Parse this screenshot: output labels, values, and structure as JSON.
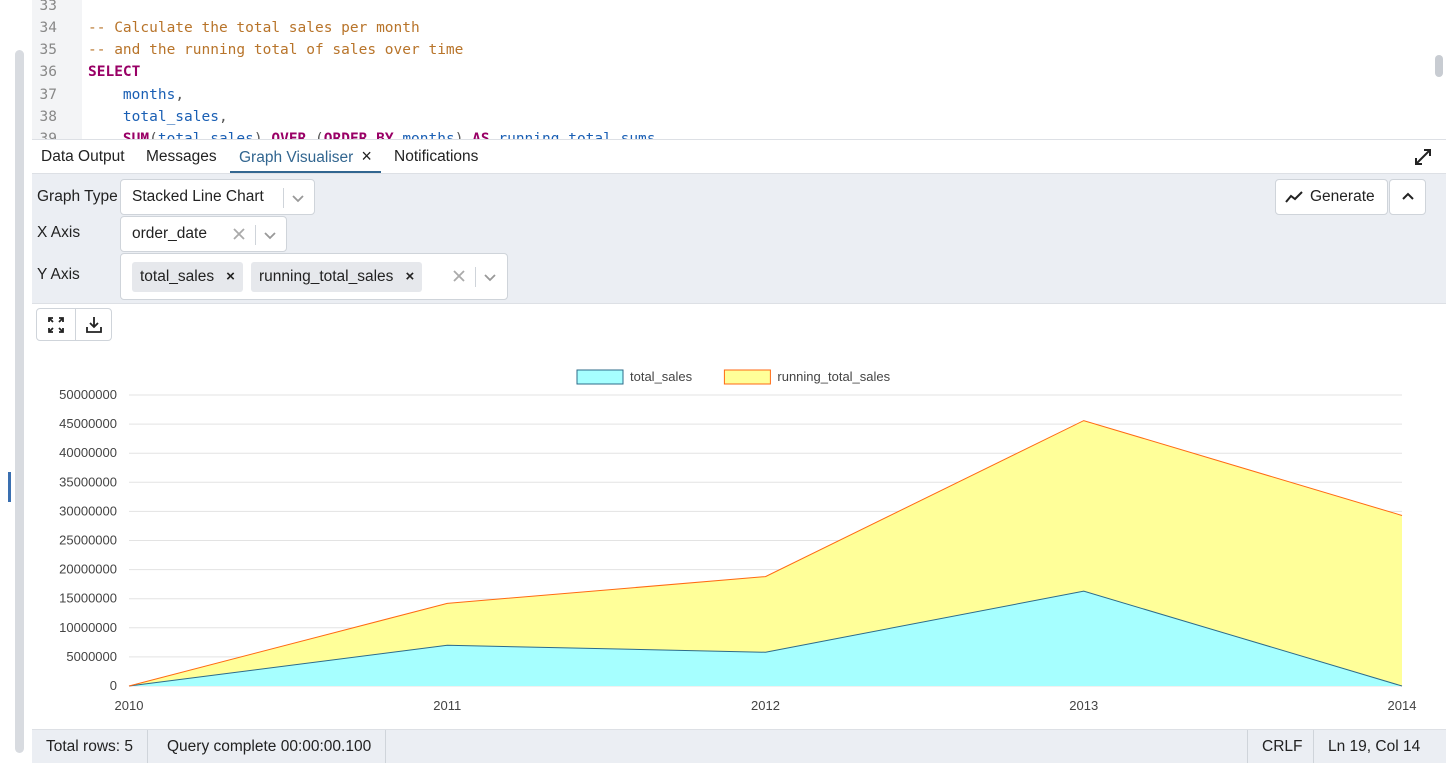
{
  "editor": {
    "lines": [
      {
        "n": "33",
        "tokens": []
      },
      {
        "n": "34",
        "tokens": [
          {
            "t": "-- Calculate the total sales per month",
            "c": "comment"
          }
        ]
      },
      {
        "n": "35",
        "tokens": [
          {
            "t": "-- and the running total of sales over time",
            "c": "comment"
          }
        ]
      },
      {
        "n": "36",
        "tokens": [
          {
            "t": "SELECT",
            "c": "kw"
          }
        ]
      },
      {
        "n": "37",
        "tokens": [
          {
            "t": "    ",
            "c": "punct"
          },
          {
            "t": "months",
            "c": "id"
          },
          {
            "t": ",",
            "c": "punct"
          }
        ]
      },
      {
        "n": "38",
        "tokens": [
          {
            "t": "    ",
            "c": "punct"
          },
          {
            "t": "total_sales",
            "c": "id"
          },
          {
            "t": ",",
            "c": "punct"
          }
        ]
      },
      {
        "n": "39",
        "tokens": [
          {
            "t": "    ",
            "c": "punct"
          },
          {
            "t": "SUM",
            "c": "kw"
          },
          {
            "t": "(",
            "c": "punct"
          },
          {
            "t": "total_sales",
            "c": "id"
          },
          {
            "t": ") ",
            "c": "punct"
          },
          {
            "t": "OVER",
            "c": "kw"
          },
          {
            "t": " (",
            "c": "punct"
          },
          {
            "t": "ORDER BY",
            "c": "kw"
          },
          {
            "t": " months",
            "c": "id"
          },
          {
            "t": ") ",
            "c": "punct"
          },
          {
            "t": "AS",
            "c": "kw"
          },
          {
            "t": " running_total_sums",
            "c": "id"
          }
        ]
      }
    ]
  },
  "tabs": {
    "data_output": "Data Output",
    "messages": "Messages",
    "graph_visualiser": "Graph Visualiser",
    "notifications": "Notifications"
  },
  "controls": {
    "graph_type_label": "Graph Type",
    "graph_type_value": "Stacked Line Chart",
    "x_axis_label": "X Axis",
    "x_axis_value": "order_date",
    "y_axis_label": "Y Axis",
    "y_axis_chips": [
      "total_sales",
      "running_total_sales"
    ],
    "generate_label": "Generate"
  },
  "chart_data": {
    "type": "area",
    "stacked": true,
    "x": [
      "2010",
      "2011",
      "2012",
      "2013",
      "2014"
    ],
    "series": [
      {
        "name": "total_sales",
        "values": [
          0,
          7000000,
          5800000,
          16300000,
          0
        ],
        "fill": "#a6ffff",
        "stroke": "#2d6b8a"
      },
      {
        "name": "running_total_sales",
        "values": [
          0,
          7200000,
          13000000,
          29300000,
          29300000
        ],
        "fill": "#ffff99",
        "stroke": "#ff6a13"
      }
    ],
    "ylim": [
      0,
      50000000
    ],
    "yticks": [
      "0",
      "5000000",
      "10000000",
      "15000000",
      "20000000",
      "25000000",
      "30000000",
      "35000000",
      "40000000",
      "45000000",
      "50000000"
    ],
    "grid": true,
    "legend": "top-center",
    "xlabel": "",
    "ylabel": "",
    "title": ""
  },
  "status": {
    "total_rows": "Total rows: 5",
    "query": "Query complete 00:00:00.100",
    "eol": "CRLF",
    "position": "Ln 19, Col 14"
  }
}
